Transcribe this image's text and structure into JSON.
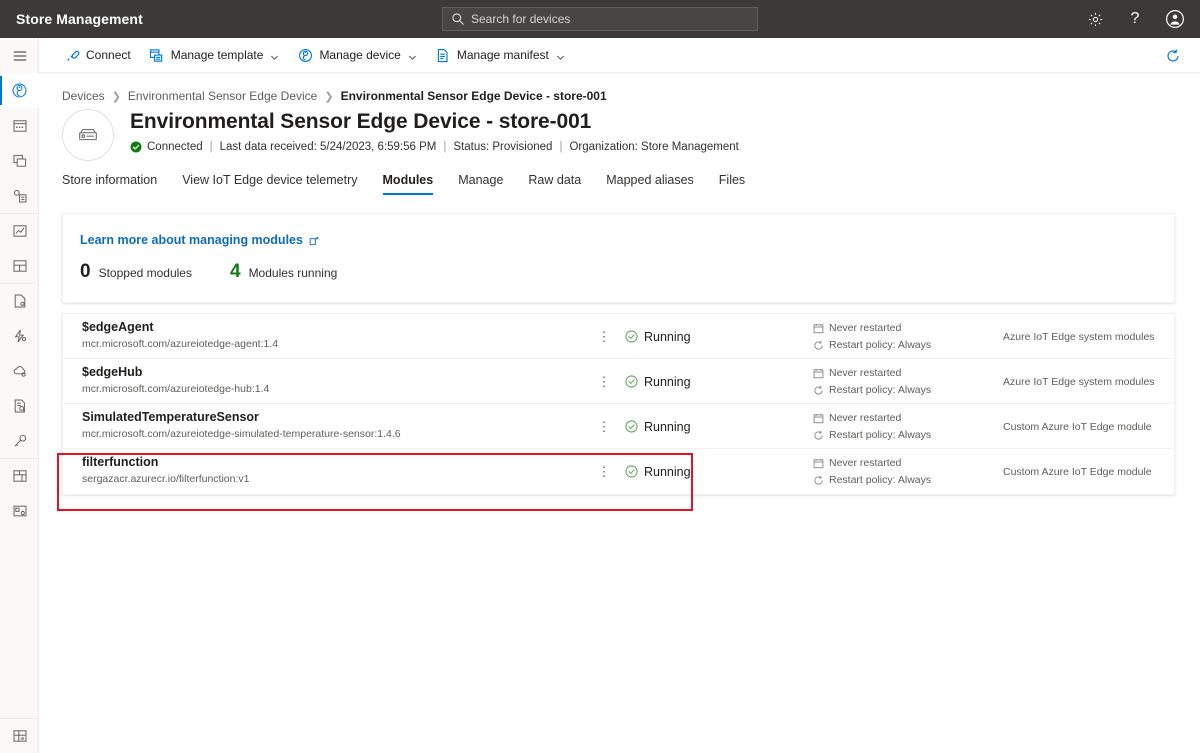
{
  "topbar": {
    "title": "Store Management",
    "search_placeholder": "Search for devices",
    "settings_icon": "gear-icon",
    "help_icon": "question-mark-icon",
    "account_icon": "user-account-icon"
  },
  "rail": {
    "hamburger": "hamburger-menu-icon",
    "items": [
      {
        "icon": "dashboard-icon",
        "active": true,
        "sep": false
      },
      {
        "icon": "devices-icon",
        "active": false,
        "sep": false
      },
      {
        "icon": "device-groups-icon",
        "active": false,
        "sep": false
      },
      {
        "icon": "device-templates-icon",
        "active": false,
        "sep": false
      },
      {
        "icon": "analytics-icon",
        "active": false,
        "sep": true
      },
      {
        "icon": "dashboards-icon",
        "active": false,
        "sep": false
      },
      {
        "icon": "jobs-icon",
        "active": false,
        "sep": true
      },
      {
        "icon": "rules-icon",
        "active": false,
        "sep": false
      },
      {
        "icon": "data-export-icon",
        "active": false,
        "sep": false
      },
      {
        "icon": "audit-logs-icon",
        "active": false,
        "sep": false
      },
      {
        "icon": "permissions-icon",
        "active": false,
        "sep": false
      },
      {
        "icon": "app-templates-icon",
        "active": false,
        "sep": true
      },
      {
        "icon": "customize-app-icon",
        "active": false,
        "sep": false
      }
    ],
    "bottom_item": {
      "icon": "extensions-icon"
    }
  },
  "commandbar": {
    "items": [
      {
        "label": "Connect",
        "icon": "connect-icon",
        "chevron": false
      },
      {
        "label": "Manage template",
        "icon": "manage-template-icon",
        "chevron": true
      },
      {
        "label": "Manage device",
        "icon": "manage-device-icon",
        "chevron": true
      },
      {
        "label": "Manage manifest",
        "icon": "manage-manifest-icon",
        "chevron": true
      }
    ],
    "refresh_icon": "refresh-icon"
  },
  "breadcrumb": [
    {
      "label": "Devices",
      "current": false
    },
    {
      "label": "Environmental Sensor Edge Device",
      "current": false
    },
    {
      "label": "Environmental Sensor Edge Device - store-001",
      "current": true
    }
  ],
  "device": {
    "avatar_icon": "edge-device-icon",
    "title": "Environmental Sensor Edge Device - store-001",
    "connection_status": "Connected",
    "connection_icon": "check-circle-filled-icon",
    "last_data_received": "Last data received: 5/24/2023, 6:59:56 PM",
    "status": "Status: Provisioned",
    "organization": "Organization: Store Management",
    "separator": "|"
  },
  "tabs": [
    {
      "label": "Store information",
      "active": false
    },
    {
      "label": "View IoT Edge device telemetry",
      "active": false
    },
    {
      "label": "Modules",
      "active": true
    },
    {
      "label": "Manage",
      "active": false
    },
    {
      "label": "Raw data",
      "active": false
    },
    {
      "label": "Mapped aliases",
      "active": false
    },
    {
      "label": "Files",
      "active": false
    }
  ],
  "info_card": {
    "learn_link": "Learn more about managing modules",
    "external_icon": "external-link-icon",
    "stopped_count": "0",
    "stopped_label": "Stopped modules",
    "running_count": "4",
    "running_label": "Modules running"
  },
  "modules": [
    {
      "name": "$edgeAgent",
      "image": "mcr.microsoft.com/azureiotedge-agent:1.4",
      "more_icon": "more-vertical-icon",
      "status": "Running",
      "status_icon": "check-circle-outline-icon",
      "restarted": "Never restarted",
      "restarted_icon": "calendar-icon",
      "restart_policy": "Restart policy: Always",
      "restart_policy_icon": "refresh-circle-icon",
      "type": "Azure IoT Edge system modules",
      "highlighted": false
    },
    {
      "name": "$edgeHub",
      "image": "mcr.microsoft.com/azureiotedge-hub:1.4",
      "more_icon": "more-vertical-icon",
      "status": "Running",
      "status_icon": "check-circle-outline-icon",
      "restarted": "Never restarted",
      "restarted_icon": "calendar-icon",
      "restart_policy": "Restart policy: Always",
      "restart_policy_icon": "refresh-circle-icon",
      "type": "Azure IoT Edge system modules",
      "highlighted": false
    },
    {
      "name": "SimulatedTemperatureSensor",
      "image": "mcr.microsoft.com/azureiotedge-simulated-temperature-sensor:1.4.6",
      "more_icon": "more-vertical-icon",
      "status": "Running",
      "status_icon": "check-circle-outline-icon",
      "restarted": "Never restarted",
      "restarted_icon": "calendar-icon",
      "restart_policy": "Restart policy: Always",
      "restart_policy_icon": "refresh-circle-icon",
      "type": "Custom Azure IoT Edge module",
      "highlighted": false
    },
    {
      "name": "filterfunction",
      "image": "sergazacr.azurecr.io/filterfunction:v1",
      "more_icon": "more-vertical-icon",
      "status": "Running",
      "status_icon": "check-circle-outline-icon",
      "restarted": "Never restarted",
      "restarted_icon": "calendar-icon",
      "restart_policy": "Restart policy: Always",
      "restart_policy_icon": "refresh-circle-icon",
      "type": "Custom Azure IoT Edge module",
      "highlighted": true
    }
  ],
  "colors": {
    "accent": "#0078d4",
    "link": "#0f6cbd",
    "success": "#107c10",
    "topbar_bg": "#3b3a39",
    "annotation": "#e81123"
  }
}
